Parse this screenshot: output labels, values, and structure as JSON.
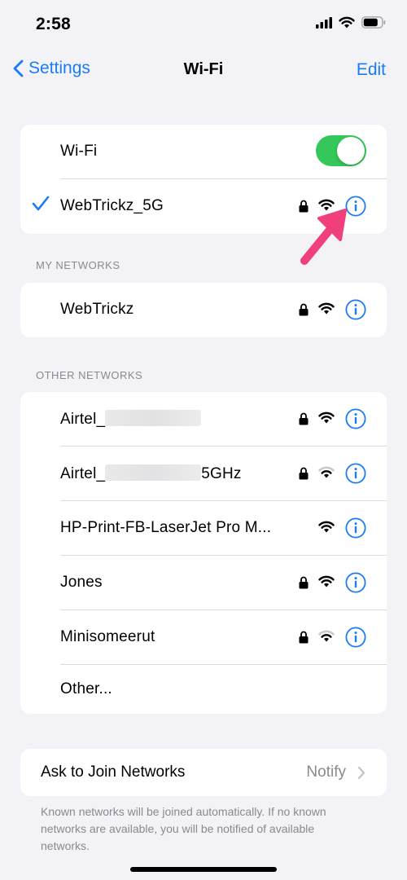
{
  "status": {
    "time": "2:58"
  },
  "nav": {
    "back_label": "Settings",
    "title": "Wi-Fi",
    "edit_label": "Edit"
  },
  "wifi": {
    "toggle_label": "Wi-Fi",
    "toggle_on": true,
    "connected_network": "WebTrickz_5G"
  },
  "my_networks": {
    "header": "MY NETWORKS",
    "items": [
      {
        "name": "WebTrickz"
      }
    ]
  },
  "other_networks": {
    "header": "OTHER NETWORKS",
    "items": [
      {
        "name": "Airtel_",
        "suffix": ""
      },
      {
        "name": "Airtel_",
        "suffix": "5GHz"
      },
      {
        "name": "HP-Print-FB-LaserJet Pro M..."
      },
      {
        "name": "Jones"
      },
      {
        "name": "Minisomeerut"
      }
    ],
    "other_label": "Other..."
  },
  "ask": {
    "label": "Ask to Join Networks",
    "value": "Notify",
    "footer": "Known networks will be joined automatically. If no known networks are available, you will be notified of available networks."
  },
  "colors": {
    "accent": "#1a7cf5",
    "toggle_on": "#34c759",
    "arrow": "#f0407c"
  }
}
